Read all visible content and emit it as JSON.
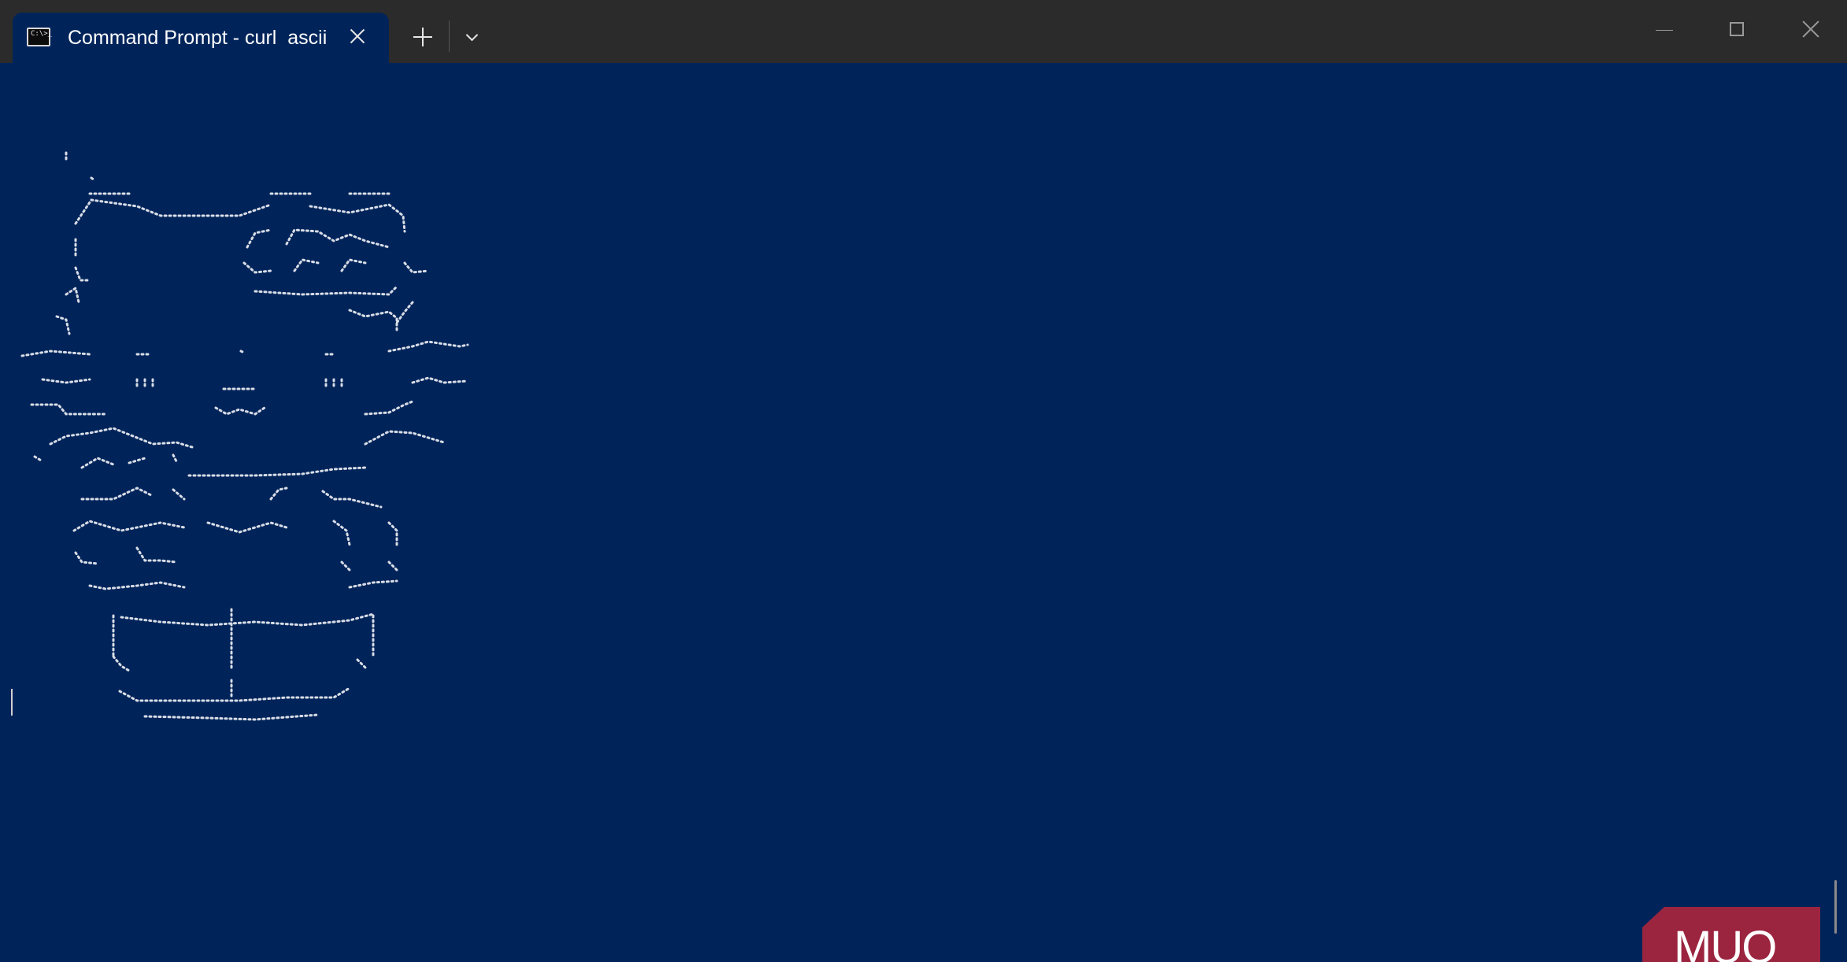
{
  "window": {
    "title": "Command Prompt - curl  ascii",
    "colors": {
      "terminal_background": "#00245a",
      "titlebar": "#2b2b2b",
      "ascii_dots": "#d9dde6",
      "watermark": "#a8253d"
    }
  },
  "tab": {
    "icon": "cmd-icon",
    "icon_text": "C:\\>_",
    "close_icon": "close-icon"
  },
  "toolbar": {
    "new_tab_icon": "plus-icon",
    "dropdown_icon": "chevron-down-icon"
  },
  "window_controls": {
    "minimize_icon": "minimize-icon",
    "maximize_icon": "maximize-icon",
    "close_icon": "close-icon"
  },
  "terminal": {
    "content": "braille ASCII art of a cat face (Hello Kitty style)",
    "cursor": "text-cursor"
  },
  "watermark": {
    "text": "MUO"
  }
}
